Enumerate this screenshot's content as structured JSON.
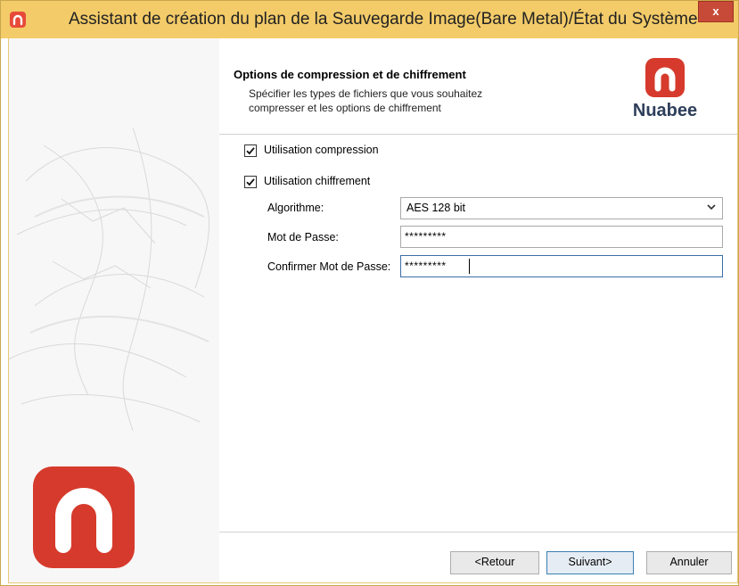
{
  "window": {
    "title": "Assistant de création du plan de la Sauvegarde Image(Bare Metal)/État du Système",
    "close_label": "x"
  },
  "header": {
    "title": "Options de compression et de chiffrement",
    "subtitle_line1": "Spécifier les types de fichiers que vous souhaitez",
    "subtitle_line2": "compresser et les options de chiffrement",
    "brand_name": "Nuabee"
  },
  "options": {
    "compression": {
      "label": "Utilisation compression",
      "checked": true
    },
    "encryption": {
      "label": "Utilisation chiffrement",
      "checked": true
    }
  },
  "fields": {
    "algorithm": {
      "label": "Algorithme:",
      "value": "AES 128 bit"
    },
    "password": {
      "label": "Mot de Passe:",
      "value": "*********"
    },
    "confirm_password": {
      "label": "Confirmer Mot de Passe:",
      "value": "*********"
    }
  },
  "buttons": {
    "back": "<Retour",
    "next": "Suivant>",
    "cancel": "Annuler"
  },
  "colors": {
    "titlebar": "#f3cb69",
    "brand_red": "#d63a2c",
    "close_button": "#c74a38"
  },
  "icons": {
    "app": "nuabee-logo-icon",
    "check": "checkmark-icon",
    "dropdown": "chevron-down-icon"
  }
}
